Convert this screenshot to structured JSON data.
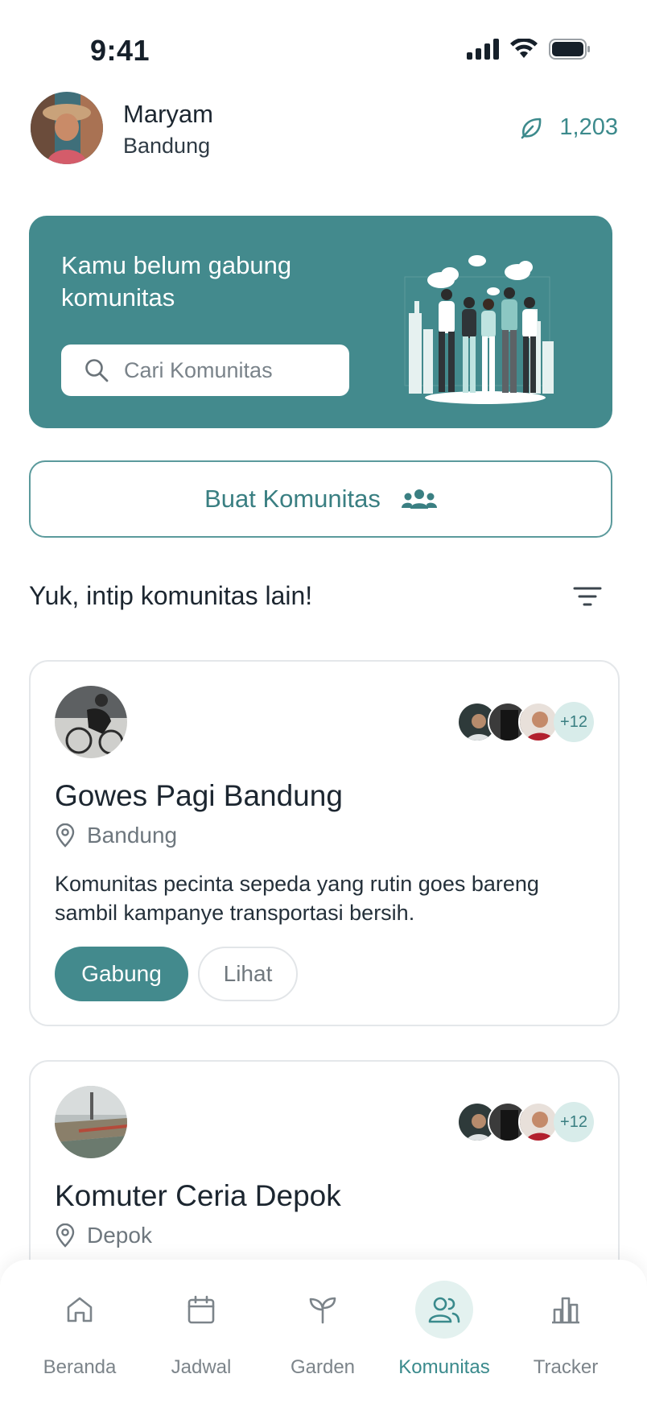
{
  "status_bar": {
    "time": "9:41"
  },
  "profile": {
    "name": "Maryam",
    "city": "Bandung",
    "points": "1,203"
  },
  "hero": {
    "title": "Kamu belum gabung komunitas",
    "search_placeholder": "Cari Komunitas"
  },
  "create_button": {
    "label": "Buat Komunitas"
  },
  "section": {
    "title": "Yuk, intip komunitas lain!"
  },
  "communities": [
    {
      "name": "Gowes Pagi Bandung",
      "location": "Bandung",
      "description": "Komunitas pecinta sepeda yang rutin goes bareng sambil kampanye transportasi bersih.",
      "members_more": "+12",
      "join_label": "Gabung",
      "view_label": "Lihat"
    },
    {
      "name": "Komuter Ceria Depok",
      "location": "Depok",
      "members_more": "+12"
    }
  ],
  "nav": [
    {
      "label": "Beranda",
      "icon": "home-icon"
    },
    {
      "label": "Jadwal",
      "icon": "calendar-icon"
    },
    {
      "label": "Garden",
      "icon": "sprout-icon"
    },
    {
      "label": "Komunitas",
      "icon": "users-icon",
      "active": true
    },
    {
      "label": "Tracker",
      "icon": "bar-chart-icon"
    }
  ],
  "colors": {
    "primary": "#438a8d",
    "accent_light": "#d8ecea",
    "text": "#1c2630"
  }
}
